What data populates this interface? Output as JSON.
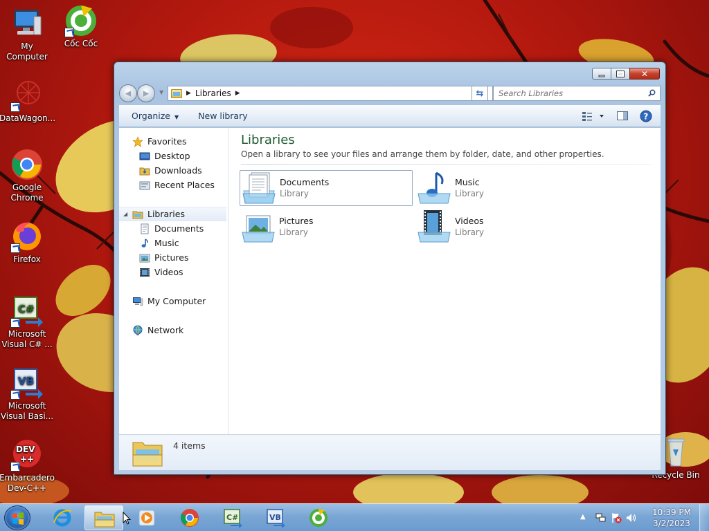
{
  "desktop": {
    "icons": [
      {
        "label": "My Computer",
        "icon": "computer-icon"
      },
      {
        "label": "Cốc Cốc",
        "icon": "coccoc-icon"
      },
      {
        "label": "DataWagon...",
        "icon": "datawagon-icon"
      },
      {
        "label": "Google Chrome",
        "icon": "chrome-icon"
      },
      {
        "label": "Firefox",
        "icon": "firefox-icon"
      },
      {
        "label": "Microsoft Visual C# ...",
        "icon": "visual-csharp-icon"
      },
      {
        "label": "Microsoft Visual Basi...",
        "icon": "visual-basic-icon"
      },
      {
        "label": "Embarcadero Dev-C++",
        "icon": "devcpp-icon"
      },
      {
        "label": "Recycle Bin",
        "icon": "recycle-bin-icon"
      }
    ]
  },
  "window": {
    "address": {
      "crumb": "Libraries"
    },
    "search": {
      "placeholder": "Search Libraries"
    },
    "toolbar": {
      "organize": "Organize",
      "new_library": "New library"
    },
    "navpane": {
      "favorites": "Favorites",
      "favorites_items": [
        "Desktop",
        "Downloads",
        "Recent Places"
      ],
      "libraries": "Libraries",
      "libraries_items": [
        "Documents",
        "Music",
        "Pictures",
        "Videos"
      ],
      "computer": "My Computer",
      "network": "Network"
    },
    "content": {
      "title": "Libraries",
      "description": "Open a library to see your files and arrange them by folder, date, and other properties.",
      "items": [
        {
          "name": "Documents",
          "type": "Library",
          "icon": "documents-library-icon"
        },
        {
          "name": "Music",
          "type": "Library",
          "icon": "music-library-icon"
        },
        {
          "name": "Pictures",
          "type": "Library",
          "icon": "pictures-library-icon"
        },
        {
          "name": "Videos",
          "type": "Library",
          "icon": "videos-library-icon"
        }
      ]
    },
    "details": {
      "count": "4 items"
    }
  },
  "taskbar": {
    "apps": [
      "internet-explorer-icon",
      "explorer-icon",
      "media-player-icon",
      "chrome-icon",
      "visual-csharp-icon",
      "visual-basic-icon",
      "coccoc-icon"
    ],
    "clock": {
      "time": "10:39 PM",
      "date": "3/2/2023"
    }
  },
  "colors": {
    "accent": "#1e5b2e",
    "taskbar": "#7aa6d5",
    "close": "#c4432d"
  }
}
